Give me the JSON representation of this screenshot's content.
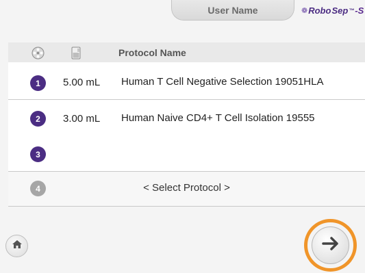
{
  "header": {
    "user_name": "User Name",
    "brand": {
      "prefix": "Robo",
      "mid": "Sep",
      "tm": "™",
      "suffix": "-S"
    }
  },
  "table": {
    "column_protocol": "Protocol Name",
    "rows": [
      {
        "number": "1",
        "volume": "5.00 mL",
        "protocol": "Human T Cell Negative Selection 19051HLA"
      },
      {
        "number": "2",
        "volume": "3.00 mL",
        "protocol": "Human Naive CD4+ T Cell Isolation 19555"
      },
      {
        "number": "3",
        "volume": "",
        "protocol": ""
      },
      {
        "number": "4",
        "volume": "",
        "protocol": "< Select Protocol >"
      }
    ]
  },
  "colors": {
    "purple": "#4b2d83",
    "grey_disc": "#a6a6a6",
    "orange_ring": "#f0952a"
  },
  "icons": {
    "quadrant": "carousel-icon",
    "volume": "tube-icon",
    "home": "home-icon",
    "next": "arrow-right-icon"
  }
}
